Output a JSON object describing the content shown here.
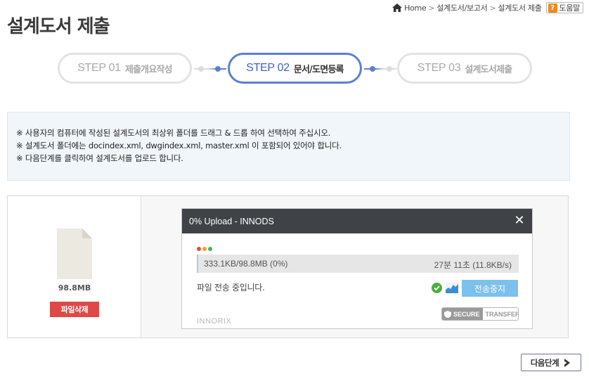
{
  "breadcrumb": {
    "items": [
      "Home",
      "설계도서/보고서",
      "설계도서 제출"
    ],
    "help_label": "도움말",
    "help_glyph": "?"
  },
  "page_title": "설계도서 제출",
  "steps": [
    {
      "num": "STEP 01",
      "label": "제출개요작성",
      "active": false
    },
    {
      "num": "STEP 02",
      "label": "문서/도면등록",
      "active": true
    },
    {
      "num": "STEP 03",
      "label": "설계도서제출",
      "active": false
    }
  ],
  "notice": [
    "※ 사용자의 컴퓨터에 작성된 설계도서의 최상위 폴더를 드래그 & 드롭 하여 선택하여 주십시오.",
    "※ 설계도서 폴더에는 docindex.xml, dwgindex.xml, master.xml 이 포함되어 있어야 합니다.",
    "※ 다음단계를 클릭하여 설계도서를 업로드 합니다."
  ],
  "file": {
    "size": "98.8MB",
    "delete_label": "파일삭제"
  },
  "dialog": {
    "title": "0% Upload - INNODS",
    "close_glyph": "✕",
    "progress_left": "333.1KB/98.8MB (0%)",
    "progress_right": "27분 11초 (11.8KB/s)",
    "progress_fraction": 0.0033,
    "status": "파일 전송 중입니다.",
    "stop_label": "전송중지",
    "secure_left": "SECURE",
    "secure_right": "TRANSFER",
    "brand": "INNORIX"
  },
  "next_label": "다음단계",
  "colors": {
    "active_step": "#5b7fd6",
    "inactive_step": "#e3e3e3",
    "delete": "#e04848",
    "stop": "#7cc0ec",
    "dialog_header": "#3f4347",
    "notice_bg": "#f1f6fa"
  }
}
